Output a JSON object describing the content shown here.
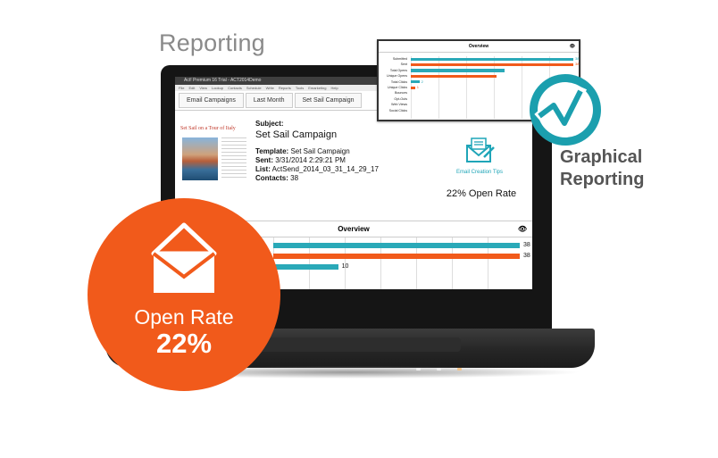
{
  "headline": "Reporting",
  "graphical": {
    "line1": "Graphical",
    "line2": "Reporting"
  },
  "app": {
    "title": "Act! Premium 16 Trial - ACT2014Demo",
    "menu": [
      "File",
      "Edit",
      "View",
      "Lookup",
      "Contacts",
      "Schedule",
      "Write",
      "Reports",
      "Tools",
      "Emarketing",
      "Help"
    ],
    "breadcrumbs": [
      "Email Campaigns",
      "Last Month",
      "Set Sail Campaign"
    ]
  },
  "campaign": {
    "thumb_title": "Set Sail on a Tour of Italy",
    "subject_label": "Subject:",
    "subject": "Set Sail Campaign",
    "template_label": "Template:",
    "template": "Set Sail Campaign",
    "sent_label": "Sent:",
    "sent": "3/31/2014 2:29:21 PM",
    "list_label": "List:",
    "list": "ActSend_2014_03_31_14_29_17",
    "contacts_label": "Contacts:",
    "contacts": "38",
    "tips": "Email Creation Tips",
    "open_rate_text": "22% Open Rate"
  },
  "overview": {
    "title": "Overview",
    "rows": [
      {
        "value": 38,
        "label": "38",
        "color": "#2aa9b8"
      },
      {
        "value": 38,
        "label": "38",
        "color": "#f15a1b"
      },
      {
        "value": 10,
        "label": "10",
        "color": "#2aa9b8"
      }
    ],
    "max": 38
  },
  "mini_overview": {
    "title": "Overview",
    "max": 38,
    "rows": [
      {
        "label": "Submitted",
        "value": 38,
        "value_label": "38",
        "color": "#2aa9b8"
      },
      {
        "label": "Sent",
        "value": 38,
        "value_label": "38",
        "color": "#f15a1b"
      },
      {
        "label": "Total Opens",
        "value": 22,
        "value_label": "",
        "color": "#2aa9b8"
      },
      {
        "label": "Unique Opens",
        "value": 20,
        "value_label": "",
        "color": "#f15a1b"
      },
      {
        "label": "Total Clicks",
        "value": 2,
        "value_label": "2",
        "color": "#2aa9b8"
      },
      {
        "label": "Unique Clicks",
        "value": 1,
        "value_label": "1",
        "color": "#f15a1b"
      },
      {
        "label": "Bounces",
        "value": 0,
        "value_label": "",
        "color": "#2aa9b8"
      },
      {
        "label": "Opt-Outs",
        "value": 0,
        "value_label": "",
        "color": "#f15a1b"
      },
      {
        "label": "Web Views",
        "value": 0,
        "value_label": "",
        "color": "#2aa9b8"
      },
      {
        "label": "Social Clicks",
        "value": 0,
        "value_label": "",
        "color": "#f15a1b"
      }
    ]
  },
  "badge": {
    "label": "Open Rate",
    "value": "22%"
  },
  "colors": {
    "teal": "#2aa9b8",
    "orange": "#f15a1b"
  },
  "icons": [
    "envelope-open-icon",
    "email-creation-tips-icon",
    "graphical-reporting-icon",
    "eye-icon"
  ]
}
